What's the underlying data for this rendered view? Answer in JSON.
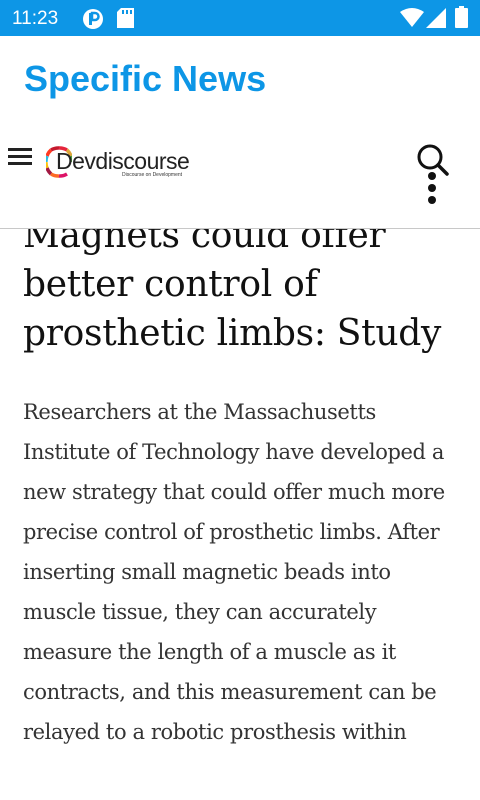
{
  "status_bar": {
    "time": "11:23",
    "icons": [
      "notification-p-icon",
      "sd-card-icon",
      "wifi-icon",
      "cell-signal-icon",
      "battery-icon"
    ],
    "background": "#0d96e6"
  },
  "app_bar": {
    "title": "Specific News",
    "title_color": "#0d96e6"
  },
  "site_header": {
    "menu_icon": "hamburger-menu-icon",
    "logo_text": "Devdiscourse",
    "logo_tagline": "Discourse on Development",
    "search_icon": "search-icon",
    "more_icon": "more-vert-icon"
  },
  "article": {
    "headline": "Magnets could offer better control of prosthetic limbs: Study",
    "body": "Researchers at the Massachusetts Institute of Technology have developed a new strategy that could offer much more precise control of prosthetic limbs. After inserting small magnetic beads into muscle tissue, they can accurately measure the length of a muscle as it contracts, and this measurement can be relayed to a robotic prosthesis within"
  }
}
